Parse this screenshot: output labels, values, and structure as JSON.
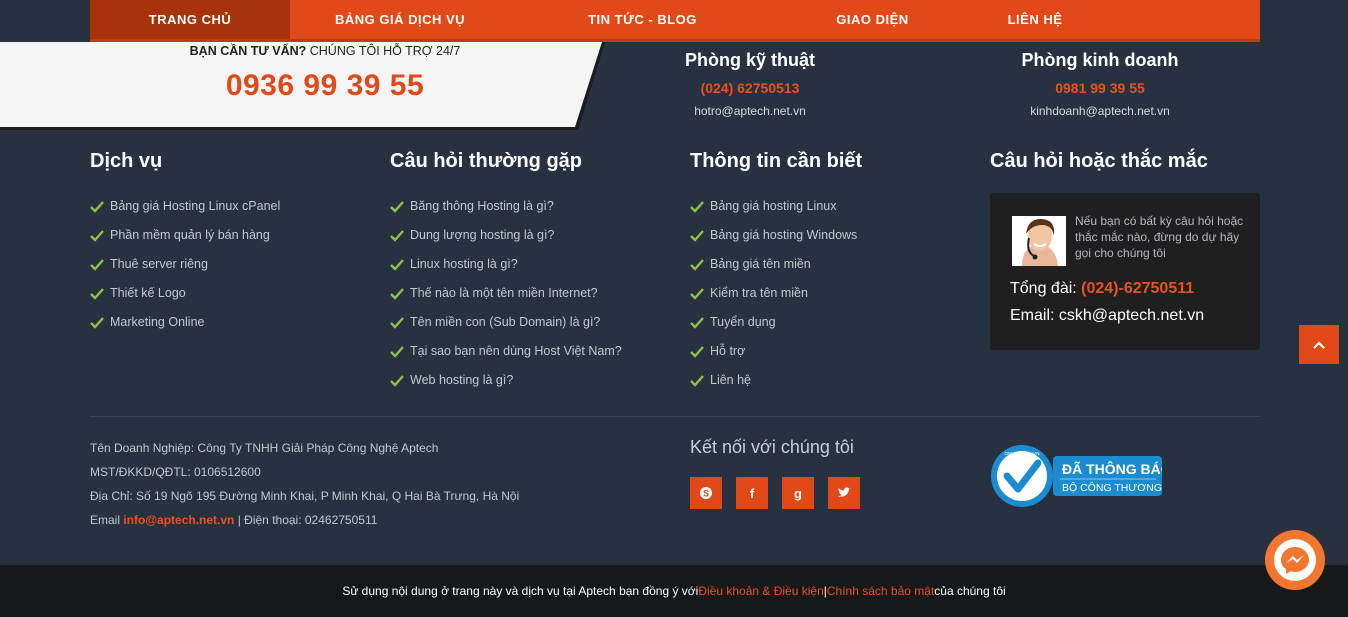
{
  "nav": {
    "items": [
      {
        "label": "TRANG CHỦ",
        "active": true
      },
      {
        "label": "BẢNG GIÁ DỊCH VỤ"
      },
      {
        "label": "TIN TỨC - BLOG"
      },
      {
        "label": "GIAO DIỆN"
      },
      {
        "label": "LIÊN HỆ"
      }
    ]
  },
  "hotline": {
    "label_bold": "BẠN CẦN TƯ VẤN?",
    "label_rest": " CHÚNG TÔI HỖ TRỢ 24/7",
    "number": "0936 99 39 55"
  },
  "departments": [
    {
      "title": "Phòng kỹ thuật",
      "phone": "(024) 62750513",
      "email": "hotro@aptech.net.vn"
    },
    {
      "title": "Phòng kinh doanh",
      "phone": "0981 99 39 55",
      "email": "kinhdoanh@aptech.net.vn"
    }
  ],
  "columns": [
    {
      "title": "Dịch vụ",
      "items": [
        "Bảng giá Hosting Linux cPanel",
        "Phần mềm quản lý bán hàng",
        "Thuê server riêng",
        "Thiết kế Logo",
        "Marketing Online"
      ]
    },
    {
      "title": "Câu hỏi thường gặp",
      "items": [
        "Băng thông Hosting là gì?",
        "Dung lượng hosting là gì?",
        "Linux hosting là gì?",
        "Thế nào là một tên miền Internet?",
        "Tên miền con (Sub Domain) là gì?",
        "Tại sao bạn nên dùng Host Việt Nam?",
        "Web hosting là gì?"
      ]
    },
    {
      "title": "Thông tin cần biết",
      "items": [
        "Bảng giá hosting Linux",
        "Bảng giá hosting Windows",
        "Bảng giá tên miền",
        "Kiểm tra tên miền",
        "Tuyển dụng",
        "Hỗ trợ",
        "Liên hệ"
      ]
    }
  ],
  "questions": {
    "title": "Câu hỏi hoặc thắc mắc",
    "text": "Nếu bạn có bất kỳ câu hỏi hoặc thắc mắc nào, đừng do dự hãy gọi cho chúng tôi",
    "switchboard_label": "Tổng đài: ",
    "switchboard_number": "(024)-62750511",
    "email_line": "Email: cskh@aptech.net.vn"
  },
  "company": {
    "name": "Tên Doanh Nghiệp: Công Ty TNHH Giải Pháp Công Nghệ Aptech",
    "tax": "MST/ĐKKD/QĐTL: 0106512600",
    "address": "Địa Chỉ: Số 19 Ngõ 195 Đường Minh Khai, P Minh Khai, Q Hai Bà Trưng, Hà Nội",
    "email_label": "Email ",
    "email": "info@aptech.net.vn",
    "phone": " | Điện thoại: 02462750511"
  },
  "social": {
    "title": "Kết nối với chúng tôi",
    "icons": [
      "skype-icon",
      "facebook-icon",
      "google-plus-icon",
      "twitter-icon"
    ]
  },
  "badge": {
    "line1": "ĐÃ THÔNG BÁO",
    "line2": "BỘ CÔNG THƯƠNG",
    "ring_text": "ONLINE.GOV.VN"
  },
  "footer": {
    "text_before": "Sử dụng nội dung ở trang này và dịch vụ tại Aptech bạn đồng ý với ",
    "terms": "Điều khoản & Điều kiện",
    "separator": " | ",
    "privacy": "Chính sách bảo mật",
    "text_after": " của chúng tôi"
  },
  "colors": {
    "accent": "#e14a18",
    "background": "#283140",
    "bottom_bar": "#17181a"
  }
}
